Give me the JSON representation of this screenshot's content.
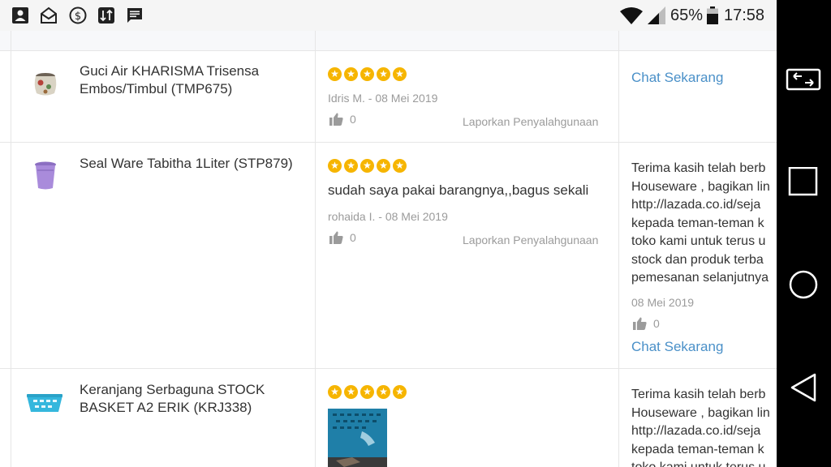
{
  "status_bar": {
    "battery": "65%",
    "time": "17:58",
    "icons": [
      "contact-icon",
      "mail-open-icon",
      "dollar-icon",
      "shuffle-app-icon",
      "message-icon",
      "wifi-icon",
      "signal-icon",
      "battery-icon"
    ]
  },
  "nav_bar": {
    "icons": [
      "screen-mirror-icon",
      "recent-apps-icon",
      "home-icon",
      "back-icon"
    ]
  },
  "reviews": [
    {
      "product": "Guci Air KHARISMA Trisensa Embos/Timbul (TMP675)",
      "stars": 5,
      "text": "",
      "reviewer": "Idris M. - 08 Mei 2019",
      "likes": "0",
      "report": "Laporkan Penyalahgunaan",
      "chat": "Chat Sekarang"
    },
    {
      "product": "Seal Ware Tabitha 1Liter (STP879)",
      "stars": 5,
      "text": "sudah saya pakai barangnya,,bagus sekali",
      "reviewer": "rohaida I. - 08 Mei 2019",
      "likes": "0",
      "report": "Laporkan Penyalahgunaan",
      "reply_lines": [
        "Terima kasih telah berb",
        "Houseware , bagikan lin",
        "http://lazada.co.id/seja",
        "kepada teman-teman k",
        "toko kami untuk terus u",
        "stock dan produk terba",
        "pemesanan selanjutnya"
      ],
      "reply_date": "08 Mei 2019",
      "reply_likes": "0",
      "chat": "Chat Sekarang"
    },
    {
      "product": "Keranjang Serbaguna STOCK BASKET A2 ERIK (KRJ338)",
      "stars": 5,
      "reply_lines": [
        "Terima kasih telah berb",
        "Houseware , bagikan lin",
        "http://lazada.co.id/seja",
        "kepada teman-teman k",
        "toko kami untuk terus u"
      ]
    }
  ],
  "colors": {
    "star": "#f6b500",
    "link": "#4a90c8",
    "text": "#333333",
    "muted": "#9b9b9b"
  }
}
